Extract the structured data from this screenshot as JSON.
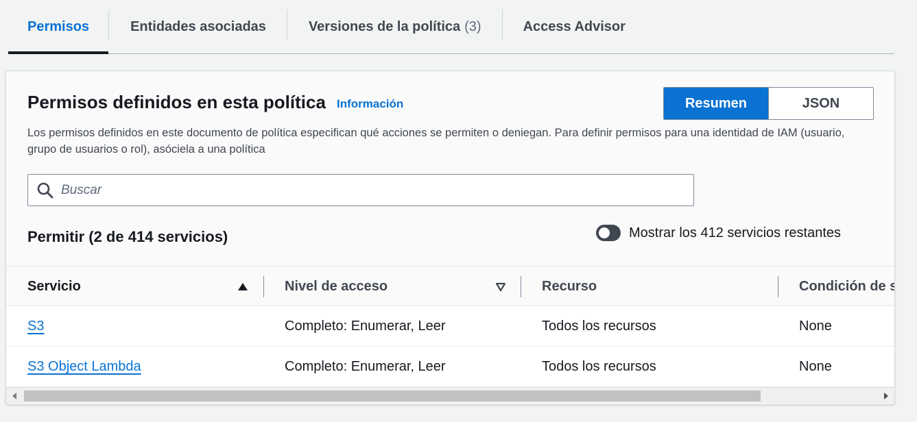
{
  "tabs": [
    {
      "label": "Permisos",
      "count": ""
    },
    {
      "label": "Entidades asociadas",
      "count": ""
    },
    {
      "label": "Versiones de la política",
      "count": "(3)"
    },
    {
      "label": "Access Advisor",
      "count": ""
    }
  ],
  "panel": {
    "title": "Permisos definidos en esta política",
    "info_link": "Información",
    "view_toggle": {
      "summary": "Resumen",
      "json": "JSON",
      "selected": "Resumen"
    },
    "description": "Los permisos definidos en este documento de política especifican qué acciones se permiten o deniegan. Para definir permisos para una identidad de IAM (usuario, grupo de usuarios o rol), asóciela a una política",
    "search": {
      "placeholder": "Buscar",
      "value": ""
    },
    "allow_title": "Permitir (2 de 414 servicios)",
    "show_remaining": {
      "label": "Mostrar los 412 servicios restantes",
      "enabled": false
    }
  },
  "table": {
    "headers": [
      "Servicio",
      "Nivel de acceso",
      "Recurso",
      "Condición de s"
    ],
    "rows": [
      {
        "service": "S3",
        "access": "Completo: Enumerar, Leer",
        "resource": "Todos los recursos",
        "condition": "None"
      },
      {
        "service": "S3 Object Lambda",
        "access": "Completo: Enumerar, Leer",
        "resource": "Todos los recursos",
        "condition": "None"
      }
    ]
  },
  "colors": {
    "accent": "#0972d3",
    "text": "#16191f",
    "background": "#f2f3f3"
  }
}
